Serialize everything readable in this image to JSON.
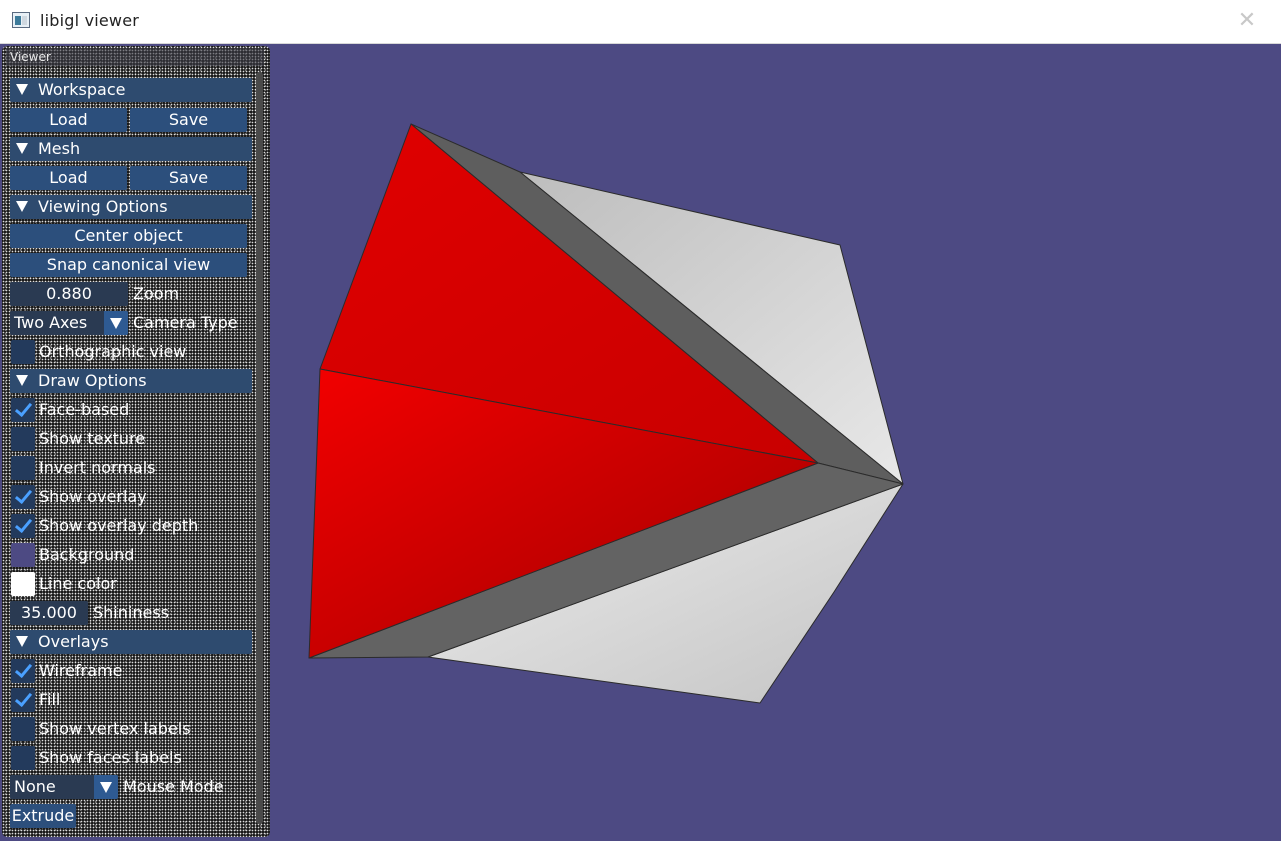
{
  "window": {
    "title": "libigl viewer",
    "close_glyph": "✕"
  },
  "panel": {
    "title": "Viewer",
    "workspace": {
      "header": "Workspace",
      "load": "Load",
      "save": "Save"
    },
    "mesh": {
      "header": "Mesh",
      "load": "Load",
      "save": "Save"
    },
    "viewing": {
      "header": "Viewing Options",
      "center_object": "Center object",
      "snap_view": "Snap canonical view",
      "zoom_value": "0.880",
      "zoom_label": "Zoom",
      "camera_type_value": "Two Axes",
      "camera_type_label": "Camera Type",
      "orthographic_label": "Orthographic view",
      "orthographic_checked": false
    },
    "draw": {
      "header": "Draw Options",
      "face_based": "Face-based",
      "face_based_checked": true,
      "show_texture": "Show texture",
      "show_texture_checked": false,
      "invert_normals": "Invert normals",
      "invert_normals_checked": false,
      "show_overlay": "Show overlay",
      "show_overlay_checked": true,
      "show_overlay_depth": "Show overlay depth",
      "show_overlay_depth_checked": true,
      "background_label": "Background",
      "background_color": "#4d4a83",
      "line_color_label": "Line color",
      "line_color": "#ffffff",
      "shininess_value": "35.000",
      "shininess_label": "Shininess"
    },
    "overlays": {
      "header": "Overlays",
      "wireframe": "Wireframe",
      "wireframe_checked": true,
      "fill": "Fill",
      "fill_checked": true,
      "vertex_labels": "Show vertex labels",
      "vertex_labels_checked": false,
      "face_labels": "Show faces labels",
      "face_labels_checked": false
    },
    "mouse_mode_value": "None",
    "mouse_mode_label": "Mouse Mode",
    "extrude": "Extrude"
  },
  "colors": {
    "viewport_bg": "#4d4a83",
    "header_bg": "#2e4b6f",
    "button_bg": "#2c4f7c",
    "check_accent": "#4aa0ff",
    "selected_faces": "#e00000",
    "mesh_light": "#d4d4d4",
    "mesh_dark": "#5f5f5f"
  }
}
